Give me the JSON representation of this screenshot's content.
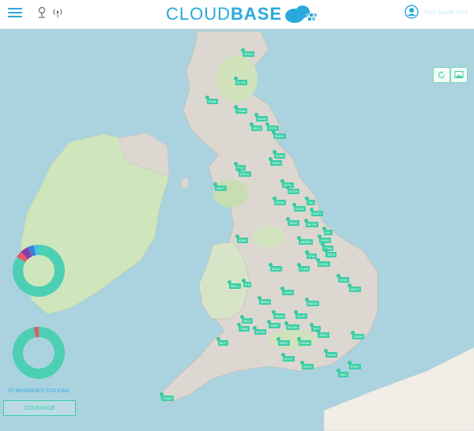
{
  "app": {
    "logo_text_light": "CLOUD",
    "logo_text_bold": "BASE"
  },
  "header": {
    "user_name": "Your name here"
  },
  "icons": {
    "menu": "hamburger-icon",
    "location": "location-pin-icon",
    "broadcast": "broadcast-icon",
    "user": "user-avatar-icon",
    "refresh": "refresh-icon",
    "image": "image-icon"
  },
  "colors": {
    "accent": "#2aa8dc",
    "station": "#3bcfa6",
    "donut_main": "#4ccfb2",
    "donut_red": "#e35a6a",
    "donut_purple": "#8b3aa8",
    "donut_blue": "#3a7fd8",
    "donut_cyan": "#44c4e8"
  },
  "stats": {
    "reference_stations": "57 REFERENCE STATIONS",
    "coverage_button": "COVERAGE"
  },
  "donut_top": {
    "segments": [
      0.84,
      0.04,
      0.05,
      0.04,
      0.03
    ]
  },
  "donut_bottom": {
    "segments": [
      0.97,
      0.03
    ]
  },
  "stations": [
    "STOH",
    "ELHD",
    "EDIN",
    "TRAN",
    "DUNY",
    "HELS",
    "OTTE",
    "ROCK",
    "STAN",
    "THRO",
    "ISLE",
    "WDLA",
    "ASHT",
    "CARL",
    "HUTR",
    "BESK",
    "TA1",
    "EOUS",
    "TADC",
    "OGTT",
    "BKTW",
    "EDIN",
    "WIGA",
    "AYL",
    "ARDEN",
    "GRIM",
    "STAI",
    "TATH",
    "DONA",
    "FLAN",
    "MALD",
    "LEWI",
    "LOND",
    "NEXT",
    "BEDM",
    "WELL",
    "IPS",
    "BRNH",
    "ABGD",
    "WLTE",
    "HICH",
    "TRAL",
    "STRO",
    "SHRT",
    "WOOD",
    "TAVI",
    "BRST",
    "DARM",
    "EOST",
    "TREV",
    "SOUT",
    "SEVN",
    "SURR",
    "PORT",
    "MOT",
    "HAIL",
    "CAMD"
  ]
}
